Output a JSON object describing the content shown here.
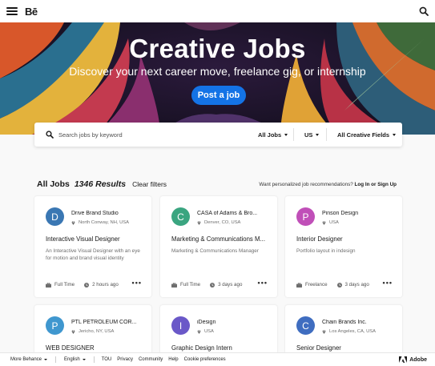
{
  "header": {
    "logo": "Bē",
    "menu_icon": "hamburger-menu-icon",
    "search_icon": "search-icon"
  },
  "hero": {
    "title": "Creative Jobs",
    "subtitle": "Discover your next career move, freelance gig, or internship",
    "post_button": "Post a job",
    "accent": "#1473e6"
  },
  "filters": {
    "search_placeholder": "Search jobs by keyword",
    "job_type": "All Jobs",
    "country": "US",
    "creative_field": "All Creative Fields"
  },
  "results": {
    "title": "All Jobs",
    "count": "1346 Results",
    "clear": "Clear filters",
    "prompt": "Want personalized job recommendations?",
    "login": "Log In or Sign Up"
  },
  "jobs": [
    {
      "initial": "D",
      "color": "#3a77b3",
      "company": "Drive Brand Studio",
      "location": "North Conway, NH, USA",
      "title": "Interactive Visual Designer",
      "description": "An Interactive Visual Designer with an eye for motion and brand visual identity",
      "type": "Full Time",
      "posted": "2 hours ago"
    },
    {
      "initial": "C",
      "color": "#3aa580",
      "company": "CASA of Adams & Bro...",
      "location": "Denver, CO, USA",
      "title": "Marketing & Communications M...",
      "description": "Marketing & Communications Manager",
      "type": "Full Time",
      "posted": "3 days ago"
    },
    {
      "initial": "P",
      "color": "#c04fb8",
      "company": "Pinson Design",
      "location": "USA",
      "title": "Interior Designer",
      "description": "Portfolio layout in indesign",
      "type": "Freelance",
      "posted": "3 days ago"
    },
    {
      "initial": "P",
      "color": "#3f97cf",
      "company": "PTL PETROLEUM COR...",
      "location": "Jericho, NY, USA",
      "title": "WEB DESIGNER"
    },
    {
      "initial": "I",
      "color": "#6a58c8",
      "company": "iDesign",
      "location": "USA",
      "title": "Graphic Design Intern"
    },
    {
      "initial": "C",
      "color": "#3f6dc0",
      "company": "Chain Brands Inc.",
      "location": "Los Angeles, CA, USA",
      "title": "Senior Designer"
    }
  ],
  "footer": {
    "more": "More Behance",
    "language": "English",
    "links": [
      "TOU",
      "Privacy",
      "Community",
      "Help",
      "Cookie preferences"
    ],
    "brand": "Adobe"
  }
}
